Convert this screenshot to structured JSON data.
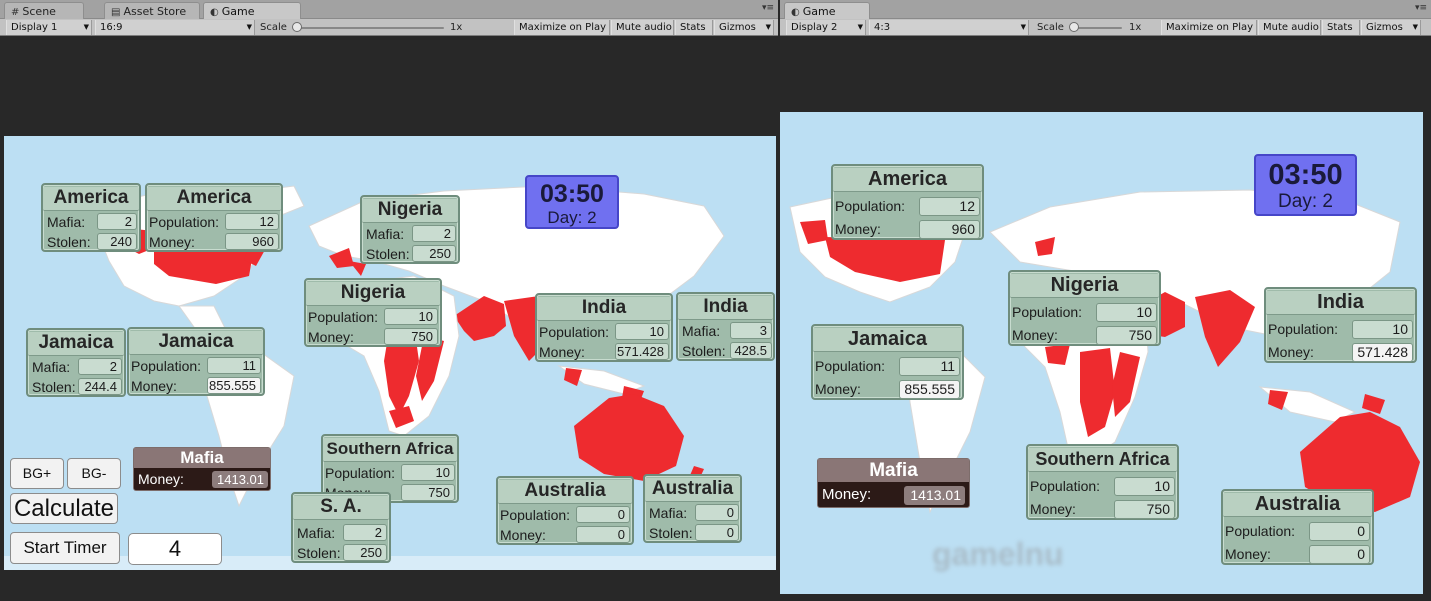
{
  "left": {
    "tabs": [
      {
        "icon": "#",
        "label": "Scene"
      },
      {
        "icon": "▤",
        "label": "Asset Store"
      },
      {
        "icon": "◐",
        "label": "Game"
      }
    ],
    "toolbar": {
      "display": "Display 1",
      "aspect": "16:9",
      "scale_label": "Scale",
      "scale_value": "1x",
      "maximize": "Maximize on Play",
      "mute": "Mute audio",
      "stats": "Stats",
      "gizmos": "Gizmos"
    },
    "timer": {
      "time": "03:50",
      "day": "Day: 2"
    },
    "regions": [
      {
        "title": "America",
        "rows": [
          {
            "label": "Mafia:",
            "value": "2"
          },
          {
            "label": "Stolen:",
            "value": "240"
          }
        ]
      },
      {
        "title": "America",
        "rows": [
          {
            "label": "Population:",
            "value": "12"
          },
          {
            "label": "Money:",
            "value": "960"
          }
        ]
      },
      {
        "title": "Nigeria",
        "rows": [
          {
            "label": "Mafia:",
            "value": "2"
          },
          {
            "label": "Stolen:",
            "value": "250"
          }
        ]
      },
      {
        "title": "Nigeria",
        "rows": [
          {
            "label": "Population:",
            "value": "10"
          },
          {
            "label": "Money:",
            "value": "750"
          }
        ]
      },
      {
        "title": "India",
        "rows": [
          {
            "label": "Population:",
            "value": "10"
          },
          {
            "label": "Money:",
            "value": "571.428"
          }
        ]
      },
      {
        "title": "India",
        "rows": [
          {
            "label": "Mafia:",
            "value": "3"
          },
          {
            "label": "Stolen:",
            "value": "428.5"
          }
        ]
      },
      {
        "title": "Jamaica",
        "rows": [
          {
            "label": "Mafia:",
            "value": "2"
          },
          {
            "label": "Stolen:",
            "value": "244.4"
          }
        ]
      },
      {
        "title": "Jamaica",
        "rows": [
          {
            "label": "Population:",
            "value": "11"
          },
          {
            "label": "Money:",
            "value": "855.555"
          }
        ]
      },
      {
        "title": "Southern Africa",
        "rows": [
          {
            "label": "Population:",
            "value": "10"
          },
          {
            "label": "Money:",
            "value": "750"
          }
        ]
      },
      {
        "title": "S. A.",
        "rows": [
          {
            "label": "Mafia:",
            "value": "2"
          },
          {
            "label": "Stolen:",
            "value": "250"
          }
        ]
      },
      {
        "title": "Australia",
        "rows": [
          {
            "label": "Population:",
            "value": "0"
          },
          {
            "label": "Money:",
            "value": "0"
          }
        ]
      },
      {
        "title": "Australia",
        "rows": [
          {
            "label": "Mafia:",
            "value": "0"
          },
          {
            "label": "Stolen:",
            "value": "0"
          }
        ]
      }
    ],
    "mafia": {
      "title": "Mafia",
      "label": "Money:",
      "value": "1413.01"
    },
    "buttons": {
      "bg_plus": "BG+",
      "bg_minus": "BG-",
      "calculate": "Calculate",
      "start_timer": "Start Timer"
    },
    "timer_input": "4"
  },
  "right": {
    "tabs": [
      {
        "icon": "◐",
        "label": "Game"
      }
    ],
    "toolbar": {
      "display": "Display 2",
      "aspect": "4:3",
      "scale_label": "Scale",
      "scale_value": "1x",
      "maximize": "Maximize on Play",
      "mute": "Mute audio",
      "stats": "Stats",
      "gizmos": "Gizmos"
    },
    "timer": {
      "time": "03:50",
      "day": "Day: 2"
    },
    "regions": [
      {
        "title": "America",
        "rows": [
          {
            "label": "Population:",
            "value": "12"
          },
          {
            "label": "Money:",
            "value": "960"
          }
        ]
      },
      {
        "title": "Nigeria",
        "rows": [
          {
            "label": "Population:",
            "value": "10"
          },
          {
            "label": "Money:",
            "value": "750"
          }
        ]
      },
      {
        "title": "India",
        "rows": [
          {
            "label": "Population:",
            "value": "10"
          },
          {
            "label": "Money:",
            "value": "571.428"
          }
        ]
      },
      {
        "title": "Jamaica",
        "rows": [
          {
            "label": "Population:",
            "value": "11"
          },
          {
            "label": "Money:",
            "value": "855.555"
          }
        ]
      },
      {
        "title": "Southern Africa",
        "rows": [
          {
            "label": "Population:",
            "value": "10"
          },
          {
            "label": "Money:",
            "value": "750"
          }
        ]
      },
      {
        "title": "Australia",
        "rows": [
          {
            "label": "Population:",
            "value": "0"
          },
          {
            "label": "Money:",
            "value": "0"
          }
        ]
      }
    ],
    "mafia": {
      "title": "Mafia",
      "label": "Money:",
      "value": "1413.01"
    },
    "watermark": "gamelnu"
  },
  "colors": {
    "ocean": "#bcdff3",
    "owned": "#ee2b2f",
    "panel": "#9fbbaa",
    "timer": "#7070f0",
    "mafia": "#2c1a17"
  }
}
